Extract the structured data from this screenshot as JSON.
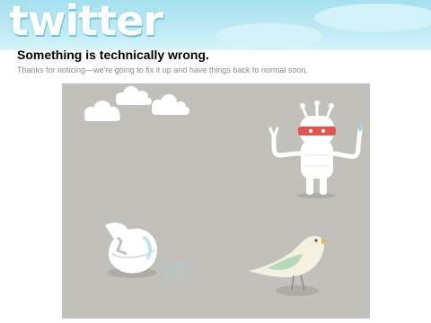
{
  "header": {
    "logo_text": "twitter"
  },
  "message": {
    "title": "Something is technically wrong.",
    "subtitle": "Thanks for noticing—we're going to fix it up and have things back to normal soon."
  },
  "illustration": {
    "background_color": "#c2c0bb",
    "visor_color": "#e0554d"
  }
}
